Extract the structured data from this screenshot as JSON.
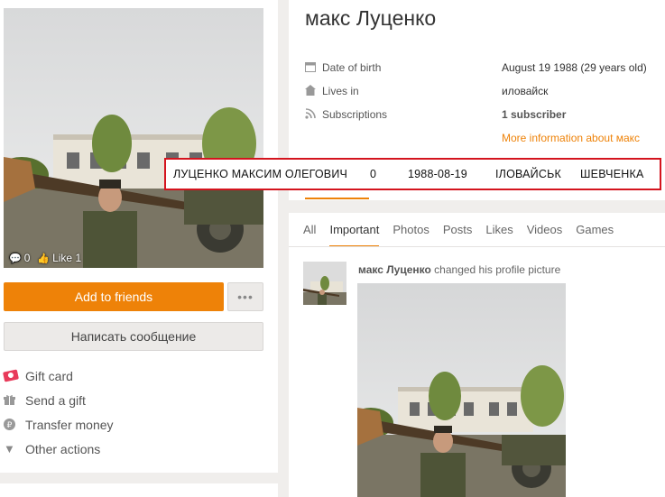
{
  "profile": {
    "name": "макс Луценко",
    "avatar_stats": {
      "comments": "0",
      "likes": "Like 1"
    }
  },
  "left": {
    "add_friends_label": "Add to friends",
    "more_label": "•••",
    "message_label": "Написать сообщение",
    "actions": [
      {
        "icon": "gift-card-icon",
        "label": "Gift card"
      },
      {
        "icon": "gift-icon",
        "label": "Send a gift"
      },
      {
        "icon": "ruble-icon",
        "label": "Transfer money"
      },
      {
        "icon": "triangle-down-icon",
        "label": "Other actions"
      }
    ]
  },
  "info": {
    "rows": [
      {
        "icon": "calendar-icon",
        "label": "Date of birth",
        "value": "August 19 1988 (29 years old)"
      },
      {
        "icon": "home-icon",
        "label": "Lives in",
        "value": "иловайск"
      },
      {
        "icon": "rss-icon",
        "label": "Subscriptions",
        "value": "1 subscriber"
      }
    ],
    "more_info": "More information about макс"
  },
  "highlight": {
    "full_name": "ЛУЦЕНКО МАКСИМ ОЛЕГОВИЧ",
    "zero": "0",
    "date": "1988-08-19",
    "city": "ІЛОВАЙСЬК",
    "street": "ШЕВЧЕНКА"
  },
  "feed": {
    "tabs": [
      "All",
      "Important",
      "Photos",
      "Posts",
      "Likes",
      "Videos",
      "Games"
    ],
    "active_tab": "Important",
    "post": {
      "author": "макс Луценко",
      "action": "changed his profile picture"
    }
  },
  "colors": {
    "accent": "#ee8208",
    "highlight_border": "#d4141e"
  }
}
